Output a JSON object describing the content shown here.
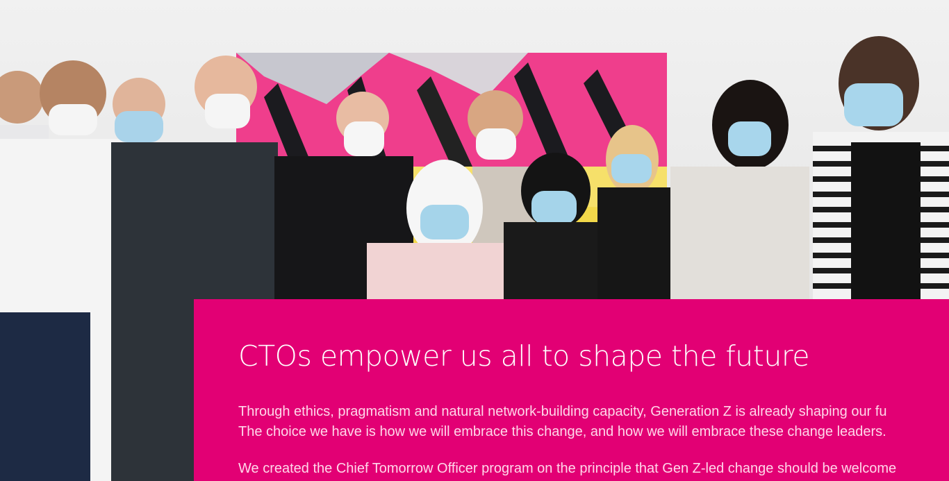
{
  "hero": {
    "image_description": "Group photo of young people wearing face masks in front of a pink and yellow abstract artwork",
    "colors": {
      "accent": "#e20074",
      "artwork_pink": "#ef3e8c",
      "artwork_yellow": "#f2d84a"
    }
  },
  "panel": {
    "headline": "CTOs empower us all to shape the future",
    "paragraphs": [
      "Through ethics, pragmatism and natural network-building capacity, Generation Z is already shaping our fu",
      "The choice we have is how we will embrace this change, and how we will embrace these change leaders.",
      "We created the Chief Tomorrow Officer program on the principle that Gen Z-led change should be welcome"
    ]
  }
}
